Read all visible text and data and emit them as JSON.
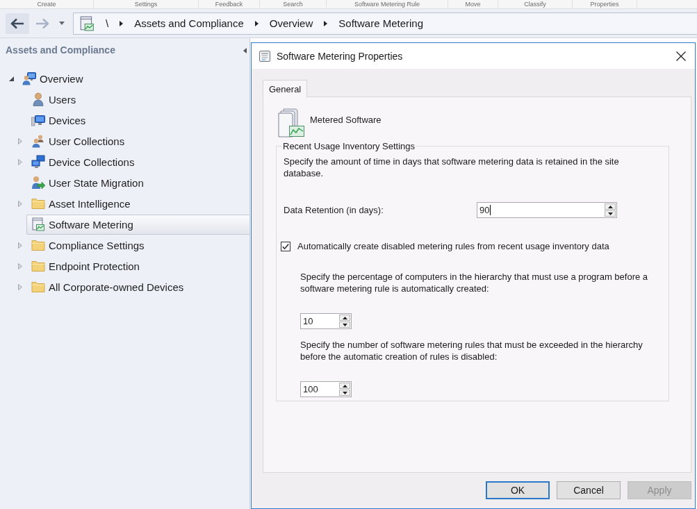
{
  "ribbon": {
    "groups": [
      "Create",
      "Settings",
      "Feedback",
      "Search",
      "Software Metering Rule",
      "Move",
      "Classify",
      "Properties"
    ]
  },
  "address_bar": {
    "back_enabled": true,
    "forward_enabled": false,
    "root": "\\",
    "path": [
      "Assets and Compliance",
      "Overview",
      "Software Metering"
    ]
  },
  "navigation": {
    "title": "Assets and Compliance",
    "tree": [
      {
        "label": "Overview",
        "kind": "overview",
        "expanded": true,
        "selected": false,
        "children": [
          {
            "label": "Users",
            "kind": "user",
            "selected": false
          },
          {
            "label": "Devices",
            "kind": "device",
            "selected": false
          },
          {
            "label": "User Collections",
            "kind": "usergroup",
            "expanded": false,
            "selected": false
          },
          {
            "label": "Device Collections",
            "kind": "devicegroup",
            "expanded": false,
            "selected": false
          },
          {
            "label": "User State Migration",
            "kind": "migration",
            "selected": false
          },
          {
            "label": "Asset Intelligence",
            "kind": "folder",
            "expanded": false,
            "selected": false
          },
          {
            "label": "Software Metering",
            "kind": "metering",
            "selected": true
          },
          {
            "label": "Compliance Settings",
            "kind": "folder",
            "expanded": false,
            "selected": false
          },
          {
            "label": "Endpoint Protection",
            "kind": "folder",
            "expanded": false,
            "selected": false
          },
          {
            "label": "All Corporate-owned Devices",
            "kind": "folder",
            "expanded": false,
            "selected": false
          }
        ]
      }
    ]
  },
  "dialog": {
    "title": "Software Metering Properties",
    "tabs": [
      {
        "label": "General",
        "selected": true
      }
    ],
    "heading": "Metered Software",
    "settings": {
      "legend": "Recent Usage Inventory Settings",
      "description": "Specify the amount of time in days that software metering data is retained in the site database.",
      "retention": {
        "label": "Data Retention (in days):",
        "value": "90",
        "focused": true
      },
      "auto_create": {
        "label": "Automatically create disabled metering rules from recent usage inventory data",
        "checked": true
      },
      "percentage": {
        "description": "Specify the percentage of computers in the hierarchy that must use a program before a software metering rule is automatically created:",
        "value": "10"
      },
      "rule_limit": {
        "description": "Specify the number of software metering rules that must be exceeded in the hierarchy before the automatic creation of rules is disabled:",
        "value": "100"
      }
    },
    "buttons": [
      {
        "label": "OK",
        "default": true,
        "disabled": false
      },
      {
        "label": "Cancel",
        "default": false,
        "disabled": false
      },
      {
        "label": "Apply",
        "default": false,
        "disabled": true
      }
    ]
  }
}
